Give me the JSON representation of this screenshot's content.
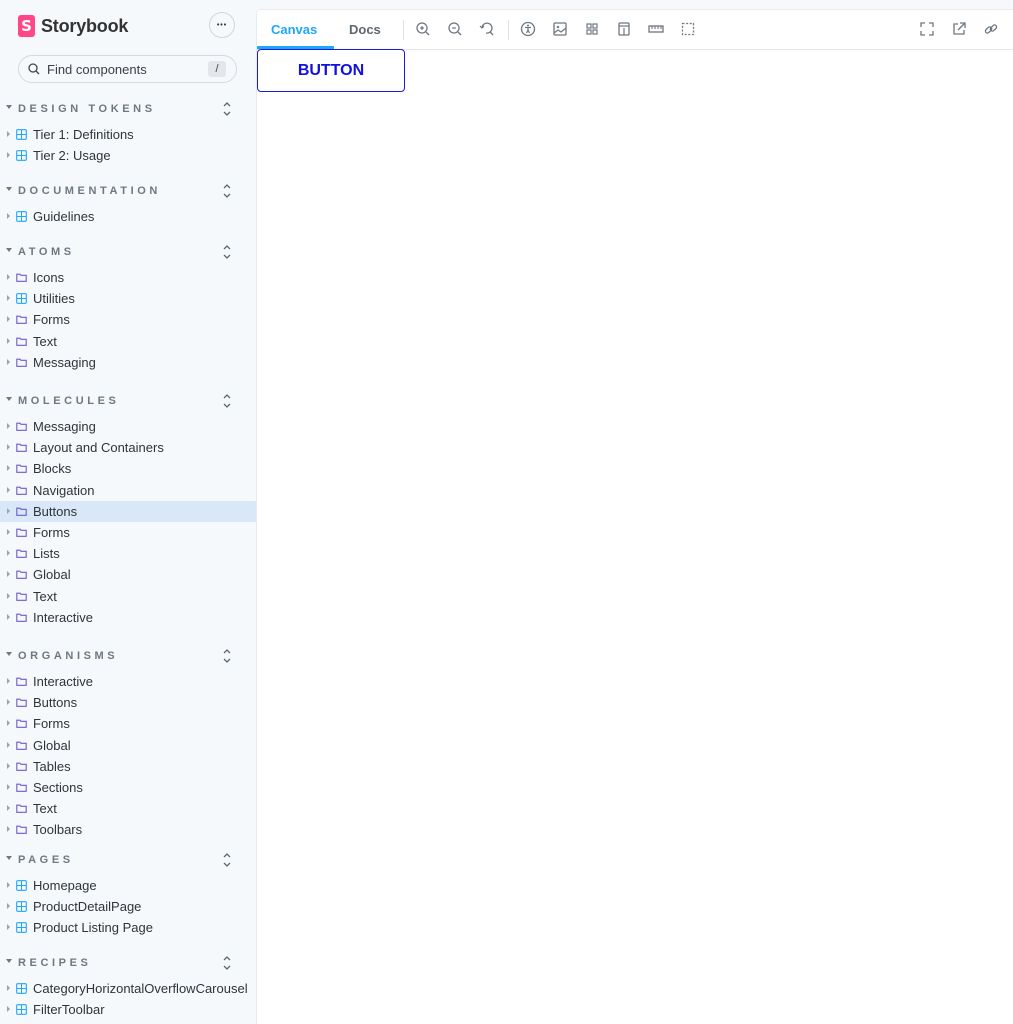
{
  "brand": {
    "name": "Storybook",
    "logo_letter": "S",
    "accent": "#ff4785"
  },
  "sidebar": {
    "menu_icon": "ellipsis-icon",
    "menu_label": "•••",
    "search": {
      "placeholder": "Find components",
      "shortcut": "/"
    },
    "sections": [
      {
        "title": "DESIGN TOKENS",
        "items": [
          {
            "label": "Tier 1: Definitions",
            "icon": "component-icon"
          },
          {
            "label": "Tier 2: Usage",
            "icon": "component-icon"
          }
        ]
      },
      {
        "title": "DOCUMENTATION",
        "items": [
          {
            "label": "Guidelines",
            "icon": "component-icon"
          }
        ]
      },
      {
        "title": "ATOMS",
        "items": [
          {
            "label": "Icons",
            "icon": "folder-icon"
          },
          {
            "label": "Utilities",
            "icon": "component-icon"
          },
          {
            "label": "Forms",
            "icon": "folder-icon"
          },
          {
            "label": "Text",
            "icon": "folder-icon"
          },
          {
            "label": "Messaging",
            "icon": "folder-icon"
          }
        ]
      },
      {
        "title": "MOLECULES",
        "items": [
          {
            "label": "Messaging",
            "icon": "folder-icon"
          },
          {
            "label": "Layout and Containers",
            "icon": "folder-icon"
          },
          {
            "label": "Blocks",
            "icon": "folder-icon"
          },
          {
            "label": "Navigation",
            "icon": "folder-icon"
          },
          {
            "label": "Buttons",
            "icon": "folder-icon",
            "selected": true
          },
          {
            "label": "Forms",
            "icon": "folder-icon"
          },
          {
            "label": "Lists",
            "icon": "folder-icon"
          },
          {
            "label": "Global",
            "icon": "folder-icon"
          },
          {
            "label": "Text",
            "icon": "folder-icon"
          },
          {
            "label": "Interactive",
            "icon": "folder-icon"
          }
        ]
      },
      {
        "title": "ORGANISMS",
        "items": [
          {
            "label": "Interactive",
            "icon": "folder-icon"
          },
          {
            "label": "Buttons",
            "icon": "folder-icon"
          },
          {
            "label": "Forms",
            "icon": "folder-icon"
          },
          {
            "label": "Global",
            "icon": "folder-icon"
          },
          {
            "label": "Tables",
            "icon": "folder-icon"
          },
          {
            "label": "Sections",
            "icon": "folder-icon"
          },
          {
            "label": "Text",
            "icon": "folder-icon"
          },
          {
            "label": "Toolbars",
            "icon": "folder-icon"
          }
        ]
      },
      {
        "title": "PAGES",
        "items": [
          {
            "label": "Homepage",
            "icon": "component-icon"
          },
          {
            "label": "ProductDetailPage",
            "icon": "component-icon"
          },
          {
            "label": "Product Listing Page",
            "icon": "component-icon"
          }
        ]
      },
      {
        "title": "RECIPES",
        "items": [
          {
            "label": "CategoryHorizontalOverflowCarousel",
            "icon": "component-icon"
          },
          {
            "label": "FilterToolbar",
            "icon": "component-icon"
          }
        ]
      }
    ]
  },
  "toolbar": {
    "tabs": [
      {
        "label": "Canvas",
        "active": true
      },
      {
        "label": "Docs",
        "active": false
      }
    ],
    "tools": [
      "zoom-in-icon",
      "zoom-out-icon",
      "zoom-reset-icon",
      "accessibility-icon",
      "background-icon",
      "grid-icon",
      "viewport-icon",
      "measure-icon",
      "outline-icon"
    ],
    "right_tools": [
      "fullscreen-icon",
      "open-new-tab-icon",
      "copy-link-icon"
    ],
    "accent": "#1ea7fd"
  },
  "preview": {
    "button_label": "BUTTON",
    "button_color": "#1010e0"
  }
}
